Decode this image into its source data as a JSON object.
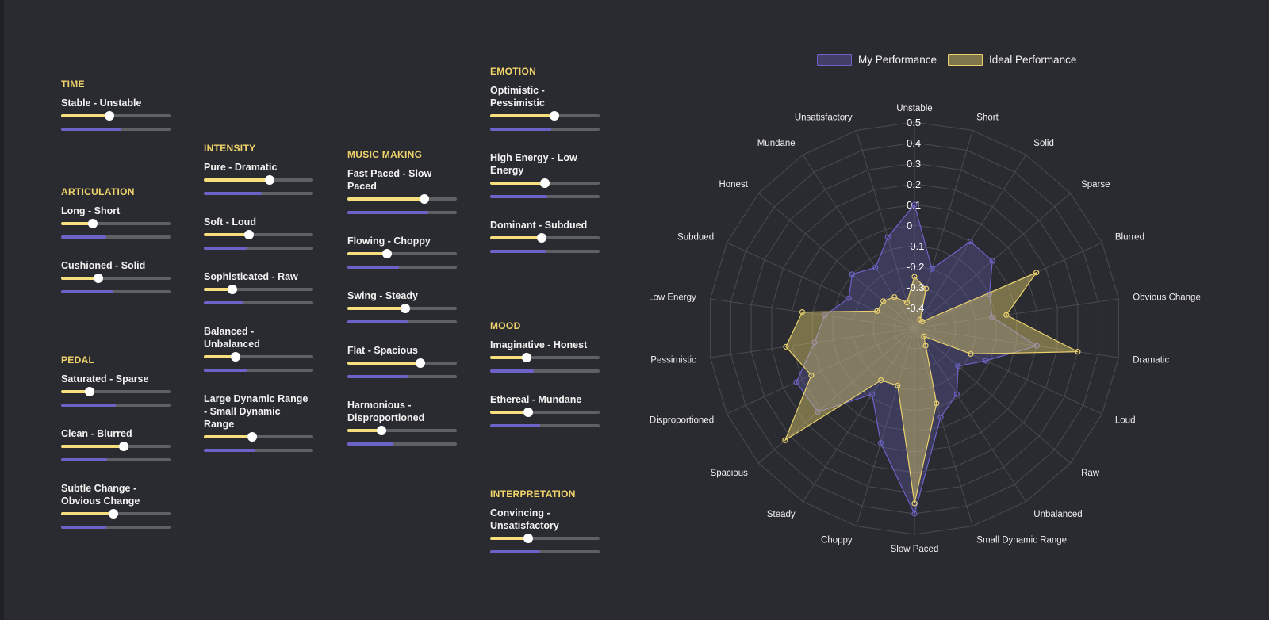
{
  "sections": {
    "time": {
      "title": "TIME",
      "sliders": [
        {
          "label": "Stable - Unstable",
          "value": 0.44,
          "compare": 0.55
        }
      ]
    },
    "articulation": {
      "title": "ARTICULATION",
      "sliders": [
        {
          "label": "Long - Short",
          "value": 0.29,
          "compare": 0.41
        },
        {
          "label": "Cushioned - Solid",
          "value": 0.34,
          "compare": 0.48
        }
      ]
    },
    "pedal": {
      "title": "PEDAL",
      "sliders": [
        {
          "label": "Saturated - Sparse",
          "value": 0.26,
          "compare": 0.5
        },
        {
          "label": "Clean - Blurred",
          "value": 0.57,
          "compare": 0.42
        },
        {
          "label": "Subtle Change - Obvious Change",
          "value": 0.48,
          "compare": 0.41
        }
      ]
    },
    "intensity": {
      "title": "INTENSITY",
      "sliders": [
        {
          "label": "Pure - Dramatic",
          "value": 0.6,
          "compare": 0.53
        },
        {
          "label": "Soft - Loud",
          "value": 0.41,
          "compare": 0.39
        },
        {
          "label": "Sophisticated - Raw",
          "value": 0.26,
          "compare": 0.36
        },
        {
          "label": "Balanced - Unbalanced",
          "value": 0.29,
          "compare": 0.39
        },
        {
          "label": "Large Dynamic Range - Small Dynamic Range",
          "value": 0.44,
          "compare": 0.47
        }
      ]
    },
    "music_making": {
      "title": "MUSIC MAKING",
      "sliders": [
        {
          "label": "Fast Paced - Slow Paced",
          "value": 0.7,
          "compare": 0.74
        },
        {
          "label": "Flowing - Choppy",
          "value": 0.36,
          "compare": 0.47
        },
        {
          "label": "Swing - Steady",
          "value": 0.53,
          "compare": 0.55
        },
        {
          "label": "Flat - Spacious",
          "value": 0.67,
          "compare": 0.55
        },
        {
          "label": "Harmonious - Disproportioned",
          "value": 0.31,
          "compare": 0.42
        }
      ]
    },
    "emotion": {
      "title": "EMOTION",
      "sliders": [
        {
          "label": "Optimistic - Pessimistic",
          "value": 0.59,
          "compare": 0.56
        },
        {
          "label": "High Energy - Low Energy",
          "value": 0.5,
          "compare": 0.52
        },
        {
          "label": "Dominant - Subdued",
          "value": 0.47,
          "compare": 0.51
        }
      ]
    },
    "mood": {
      "title": "MOOD",
      "sliders": [
        {
          "label": "Imaginative - Honest",
          "value": 0.33,
          "compare": 0.4
        },
        {
          "label": "Ethereal - Mundane",
          "value": 0.35,
          "compare": 0.46
        }
      ]
    },
    "interpretation": {
      "title": "INTERPRETATION",
      "sliders": [
        {
          "label": "Convincing - Unsatisfactory",
          "value": 0.35,
          "compare": 0.46
        }
      ]
    }
  },
  "legend": {
    "my_label": "My Performance",
    "ideal_label": "Ideal Performance"
  },
  "colors": {
    "accent_yellow": "#f6df7c",
    "accent_blue": "#6c63c9",
    "section_title": "#f1d36b",
    "background": "#2a2b30"
  },
  "chart_data": {
    "type": "radar",
    "axes": [
      "Unstable",
      "Short",
      "Solid",
      "Sparse",
      "Blurred",
      "Obvious Change",
      "Dramatic",
      "Loud",
      "Raw",
      "Unbalanced",
      "Small Dynamic Range",
      "Slow Paced",
      "Choppy",
      "Steady",
      "Spacious",
      "Disproportioned",
      "Pessimistic",
      "Low Energy",
      "Subdued",
      "Honest",
      "Mundane",
      "Unsatisfactory"
    ],
    "ticks": [
      "0.5",
      "0.4",
      "0.3",
      "0.2",
      "0.1",
      "0",
      "-0.1",
      "-0.2",
      "-0.3",
      "-0.4"
    ],
    "rmin": -0.5,
    "rmax": 0.5,
    "series": [
      {
        "name": "My Performance",
        "values": [
          0.1,
          -0.2,
          0.0,
          0.0,
          -0.1,
          -0.12,
          0.1,
          -0.12,
          -0.22,
          -0.12,
          -0.05,
          0.4,
          0.08,
          -0.12,
          0.12,
          0.13,
          -0.01,
          -0.06,
          -0.15,
          -0.1,
          -0.15,
          -0.04
        ]
      },
      {
        "name": "Ideal Performance",
        "values": [
          -0.25,
          -0.3,
          -0.45,
          -0.45,
          0.15,
          -0.05,
          0.3,
          -0.2,
          -0.44,
          -0.4,
          -0.12,
          0.35,
          -0.21,
          -0.2,
          0.33,
          0.05,
          0.13,
          0.05,
          -0.3,
          -0.3,
          -0.32,
          -0.37
        ]
      }
    ]
  }
}
